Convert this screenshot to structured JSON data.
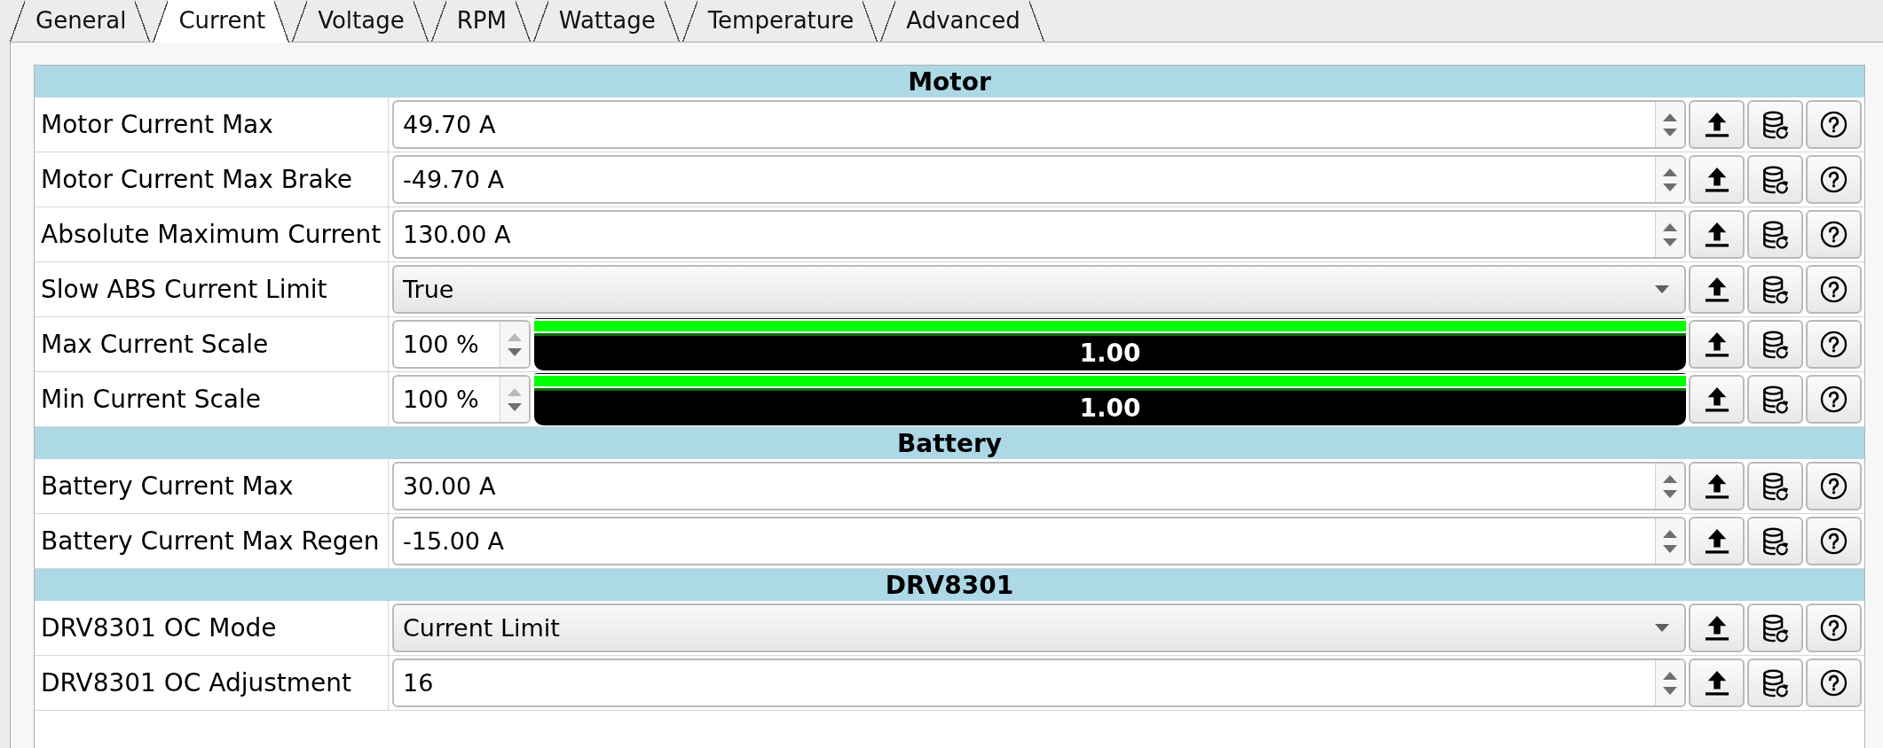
{
  "tabs": [
    {
      "label": "General",
      "selected": false
    },
    {
      "label": "Current",
      "selected": true
    },
    {
      "label": "Voltage",
      "selected": false
    },
    {
      "label": "RPM",
      "selected": false
    },
    {
      "label": "Wattage",
      "selected": false
    },
    {
      "label": "Temperature",
      "selected": false
    },
    {
      "label": "Advanced",
      "selected": false
    }
  ],
  "sections": [
    {
      "title": "Motor",
      "rows": [
        {
          "kind": "spin",
          "label": "Motor Current Max",
          "value": "49.70 A",
          "up_disabled": false
        },
        {
          "kind": "spin",
          "label": "Motor Current Max Brake",
          "value": "-49.70 A",
          "up_disabled": false
        },
        {
          "kind": "spin",
          "label": "Absolute Maximum Current",
          "value": "130.00 A",
          "up_disabled": false
        },
        {
          "kind": "combo",
          "label": "Slow ABS Current Limit",
          "value": "True"
        },
        {
          "kind": "scale",
          "label": "Max Current Scale",
          "value": "100 %",
          "up_disabled": true,
          "level": 1,
          "reading": "1.00"
        },
        {
          "kind": "scale",
          "label": "Min Current Scale",
          "value": "100 %",
          "up_disabled": true,
          "level": 1,
          "reading": "1.00"
        }
      ]
    },
    {
      "title": "Battery",
      "rows": [
        {
          "kind": "spin",
          "label": "Battery Current Max",
          "value": "30.00 A",
          "up_disabled": false
        },
        {
          "kind": "spin",
          "label": "Battery Current Max Regen",
          "value": "-15.00 A",
          "up_disabled": false
        }
      ]
    },
    {
      "title": "DRV8301",
      "rows": [
        {
          "kind": "combo",
          "label": "DRV8301 OC Mode",
          "value": "Current Limit"
        },
        {
          "kind": "spin",
          "label": "DRV8301 OC Adjustment",
          "value": "16",
          "up_disabled": false
        }
      ]
    }
  ]
}
